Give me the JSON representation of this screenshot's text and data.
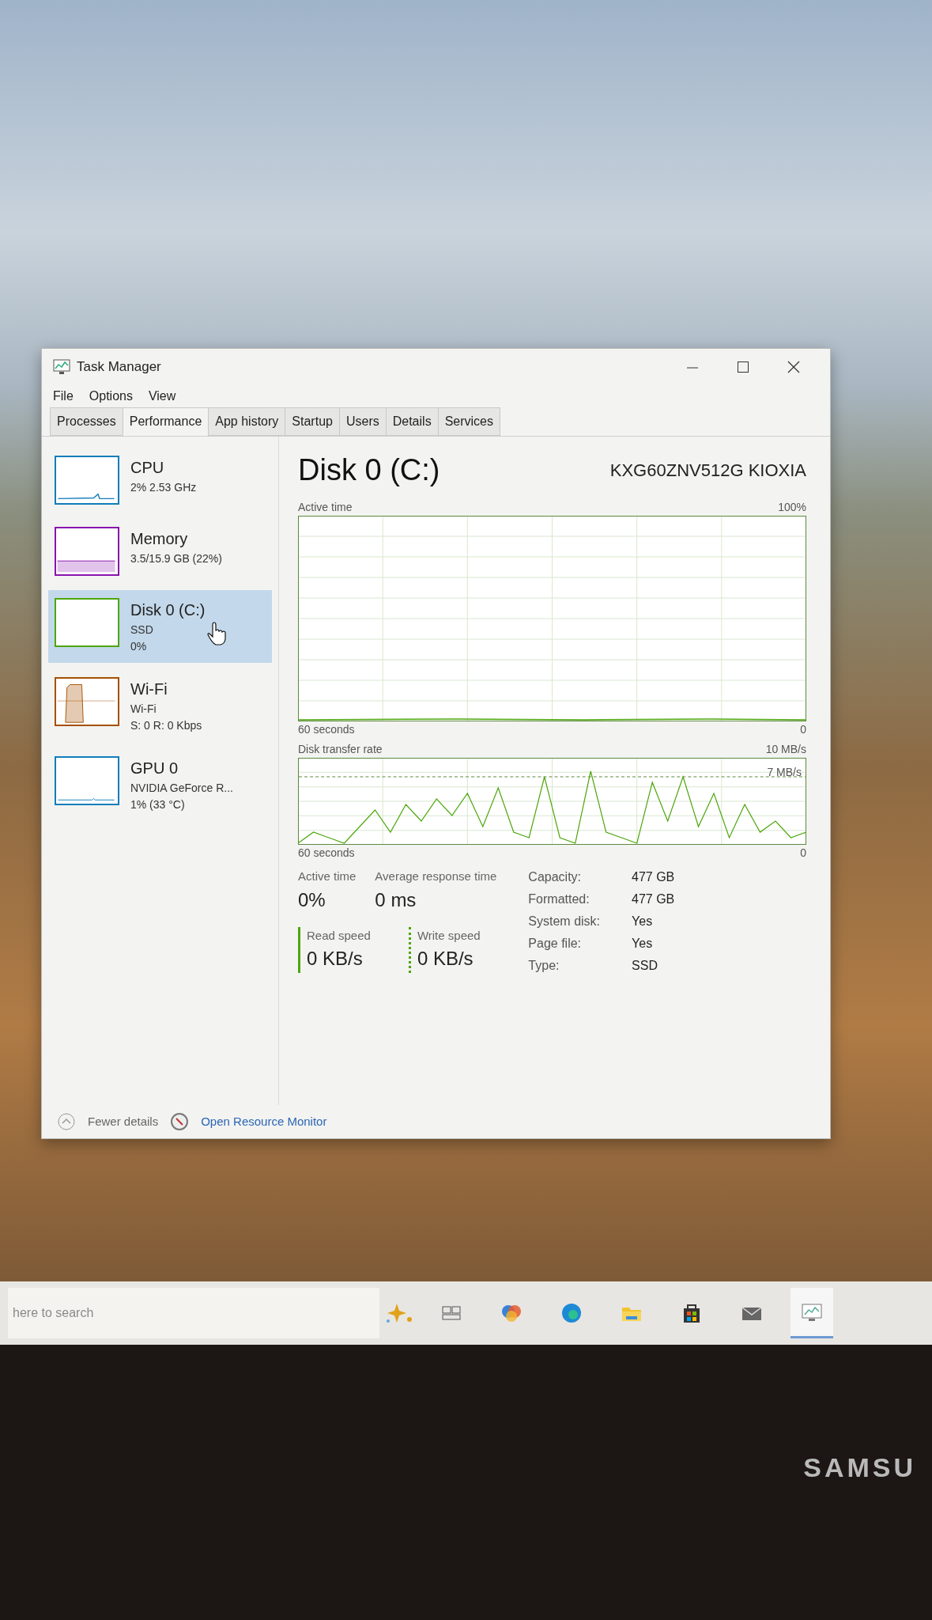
{
  "window": {
    "title": "Task Manager"
  },
  "menu": [
    "File",
    "Options",
    "View"
  ],
  "tabs": [
    {
      "label": "Processes",
      "selected": false
    },
    {
      "label": "Performance",
      "selected": true
    },
    {
      "label": "App history",
      "selected": false
    },
    {
      "label": "Startup",
      "selected": false
    },
    {
      "label": "Users",
      "selected": false
    },
    {
      "label": "Details",
      "selected": false
    },
    {
      "label": "Services",
      "selected": false
    }
  ],
  "sidebar": {
    "items": [
      {
        "kind": "cpu",
        "name": "CPU",
        "details": [
          "2% 2.53 GHz"
        ],
        "color": "#117dbb",
        "selected": false
      },
      {
        "kind": "memory",
        "name": "Memory",
        "details": [
          "3.5/15.9 GB (22%)"
        ],
        "color": "#8b12ae",
        "selected": false
      },
      {
        "kind": "disk",
        "name": "Disk 0 (C:)",
        "details": [
          "SSD",
          "0%"
        ],
        "color": "#4da60c",
        "selected": true
      },
      {
        "kind": "network",
        "name": "Wi-Fi",
        "details": [
          "Wi-Fi",
          "S: 0 R: 0 Kbps"
        ],
        "color": "#a74f01",
        "selected": false
      },
      {
        "kind": "gpu",
        "name": "GPU 0",
        "details": [
          "NVIDIA GeForce R...",
          "1% (33 °C)"
        ],
        "color": "#117dbb",
        "selected": false
      }
    ]
  },
  "detail": {
    "title": "Disk 0 (C:)",
    "model": "KXG60ZNV512G KIOXIA",
    "active_time_graph": {
      "label": "Active time",
      "max": "100%",
      "span": "60 seconds",
      "min": "0"
    },
    "transfer_graph": {
      "label": "Disk transfer rate",
      "max": "10 MB/s",
      "marker": "7 MB/s",
      "span": "60 seconds",
      "min": "0"
    },
    "stats": [
      {
        "label": "Active time",
        "value": "0%"
      },
      {
        "label": "Average response time",
        "value": "0 ms"
      }
    ],
    "speeds": [
      {
        "kind": "read",
        "label": "Read speed",
        "value": "0 KB/s"
      },
      {
        "kind": "write",
        "label": "Write speed",
        "value": "0 KB/s"
      }
    ],
    "properties": [
      {
        "label": "Capacity:",
        "value": "477 GB"
      },
      {
        "label": "Formatted:",
        "value": "477 GB"
      },
      {
        "label": "System disk:",
        "value": "Yes"
      },
      {
        "label": "Page file:",
        "value": "Yes"
      },
      {
        "label": "Type:",
        "value": "SSD"
      }
    ]
  },
  "footer": {
    "fewer_details": "Fewer details",
    "resource_monitor": "Open Resource Monitor"
  },
  "taskbar": {
    "search": {
      "placeholder": "here to search"
    },
    "apps": [
      {
        "kind": "task-view",
        "active": false
      },
      {
        "kind": "chat",
        "active": false
      },
      {
        "kind": "browser",
        "active": false
      },
      {
        "kind": "folder",
        "active": false
      },
      {
        "kind": "store",
        "active": false
      },
      {
        "kind": "mail",
        "active": false
      },
      {
        "kind": "monitor",
        "active": true
      }
    ]
  },
  "monitor": {
    "brand": "SAMSU"
  }
}
